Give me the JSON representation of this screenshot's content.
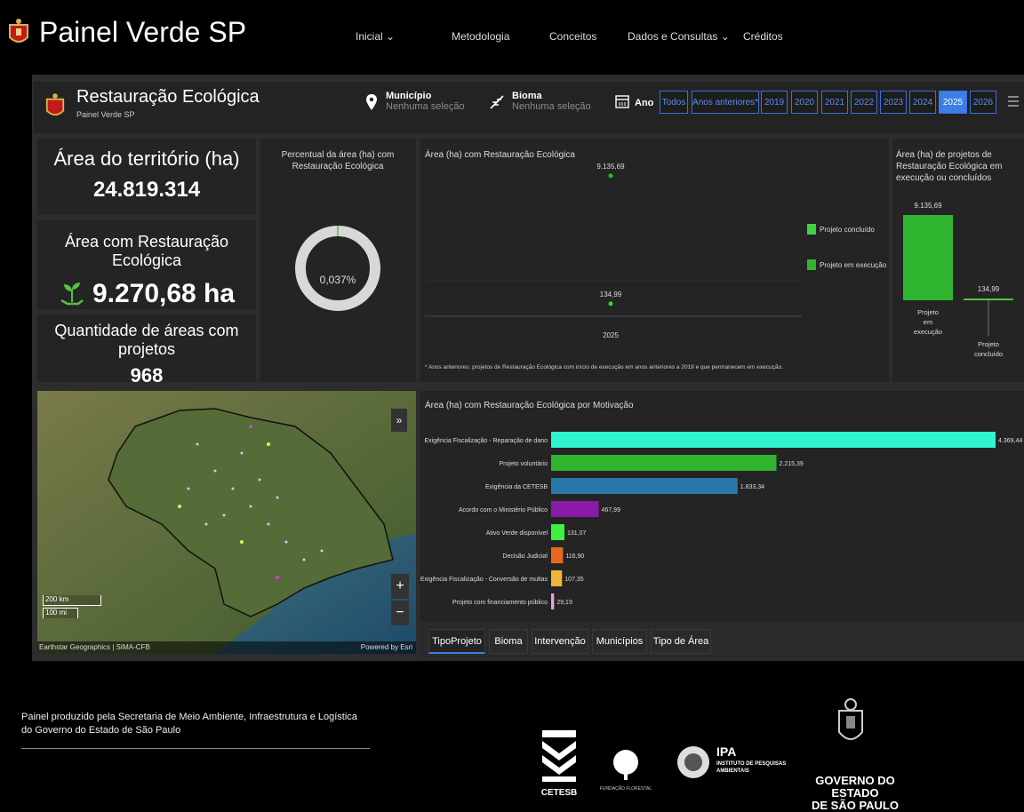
{
  "app": {
    "title": "Painel Verde SP"
  },
  "nav": [
    {
      "label": "Inicial ⌄"
    },
    {
      "label": "Metodologia"
    },
    {
      "label": "Conceitos"
    },
    {
      "label": "Dados e Consultas ⌄"
    },
    {
      "label": "Créditos"
    }
  ],
  "header": {
    "title": "Restauração Ecológica",
    "subtitle": "Painel Verde SP",
    "municipio_label": "Município",
    "municipio_value": "Nenhuma seleção",
    "bioma_label": "Bioma",
    "bioma_value": "Nenhuma seleção",
    "ano_label": "Ano",
    "years": [
      "Todos",
      "Anos anteriores*",
      "2019",
      "2020",
      "2021",
      "2022",
      "2023",
      "2024",
      "2025",
      "2026"
    ],
    "active_year": "2025"
  },
  "kpis": {
    "area_territorio_title": "Área do território (ha)",
    "area_territorio_value": "24.819.314",
    "area_restauracao_title": "Área com Restauração Ecológica",
    "area_restauracao_value": "9.270,68 ha",
    "qtd_areas_title": "Quantidade de áreas com projetos",
    "qtd_areas_value": "968"
  },
  "donut": {
    "title": "Percentual da área (ha) com Restauração Ecológica",
    "value_label": "0,037%",
    "fraction": 0.00037
  },
  "scatter": {
    "title": "Área (ha) com Restauração Ecológica",
    "footnote": "* Anos anteriores: projetos de Restauração Ecológica com início de execução em anos anteriores a 2019 e que permanecem em execução.",
    "legend": [
      "Projeto concluído",
      "Projeto em execução"
    ]
  },
  "status_bar": {
    "title": "Área (ha) de projetos de Restauração Ecológica em execução ou concluídos"
  },
  "motivacao": {
    "title": "Área (ha) com Restauração Ecológica por Motivação"
  },
  "map": {
    "scale_km": "200 km",
    "scale_mi": "100 mi",
    "attribution": "Earthstar Geographics | SIMA-CFB",
    "powered": "Powered by Esri",
    "zoom_in": "+",
    "zoom_out": "−",
    "collapse": "»"
  },
  "tabs": [
    "TipoProjeto",
    "Bioma",
    "Intervenção",
    "Municípios",
    "Tipo de Área"
  ],
  "footer": {
    "text": "Painel produzido pela Secretaria de Meio Ambiente, Infraestrutura e Logística do Governo do Estado de São Paulo",
    "cetesb": "CETESB",
    "fundacao": "FUNDAÇÃO FLORESTAL",
    "ipa": "IPA",
    "ipa_sub": "INSTITUTO DE PESQUISAS AMBIENTAIS",
    "gov_line1": "GOVERNO DO ESTADO",
    "gov_line2": "DE SÃO PAULO"
  },
  "colors": {
    "accent": "#3d7ee6",
    "green": "#2fb52f",
    "cyan": "#2ef5cf",
    "blue": "#2a78a8",
    "purple": "#8a1aa8",
    "lime": "#3ff03f",
    "orange": "#e8671e",
    "yellow": "#f0b43a",
    "pink": "#e8a0e8"
  },
  "chart_data": [
    {
      "type": "scatter",
      "title": "Área (ha) com Restauração Ecológica",
      "categories": [
        "2025"
      ],
      "series": [
        {
          "name": "Projeto concluído",
          "values": [
            134.99
          ],
          "labels": [
            "134,99"
          ]
        },
        {
          "name": "Projeto em execução",
          "values": [
            9135.69
          ],
          "labels": [
            "9.135,69"
          ]
        }
      ]
    },
    {
      "type": "bar",
      "title": "Área (ha) de projetos de Restauração Ecológica em execução ou concluídos",
      "categories": [
        "Projeto em execução",
        "Projeto concluído"
      ],
      "values": [
        9135.69,
        134.99
      ],
      "labels": [
        "9.135,69",
        "134,99"
      ]
    },
    {
      "type": "bar",
      "orientation": "horizontal",
      "title": "Área (ha) com Restauração Ecológica por Motivação",
      "categories": [
        "Exigência Fiscalização - Reparação de dano",
        "Projeto voluntário",
        "Exigência da CETESB",
        "Acordo com o Ministério Público",
        "Ativo Verde disponível",
        "Decisão Judicial",
        "Exigência Fiscalização - Conversão de multas",
        "Projeto com financiamento público"
      ],
      "values": [
        4369.44,
        2215.39,
        1833.34,
        467.99,
        131.07,
        116.9,
        107.35,
        29.19
      ],
      "labels": [
        "4.369,44",
        "2.215,39",
        "1.833,34",
        "467,99",
        "131,07",
        "116,90",
        "107,35",
        "29,19"
      ],
      "colors": [
        "#2ef5cf",
        "#2fb52f",
        "#2a78a8",
        "#8a1aa8",
        "#3ff03f",
        "#e8671e",
        "#f0b43a",
        "#e8a0e8"
      ]
    }
  ]
}
